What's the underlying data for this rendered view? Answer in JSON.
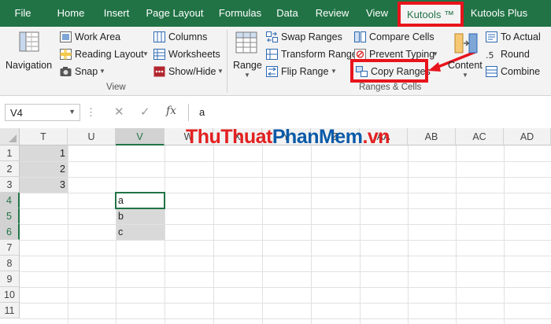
{
  "tabs": {
    "file": "File",
    "home": "Home",
    "insert": "Insert",
    "page_layout": "Page Layout",
    "formulas": "Formulas",
    "data": "Data",
    "review": "Review",
    "view": "View",
    "kutools": "Kutools ™",
    "kutools_plus": "Kutools Plus"
  },
  "ribbon": {
    "view_group": {
      "label": "View",
      "navigation": "Navigation",
      "work_area": "Work Area",
      "reading_layout": "Reading Layout",
      "snap": "Snap",
      "columns": "Columns",
      "worksheets": "Worksheets",
      "show_hide": "Show/Hide"
    },
    "ranges_group": {
      "label": "Ranges & Cells",
      "range": "Range",
      "swap_ranges": "Swap Ranges",
      "transform_range": "Transform Range",
      "flip_range": "Flip Range",
      "compare_cells": "Compare Cells",
      "prevent_typing": "Prevent Typing",
      "copy_ranges": "Copy Ranges",
      "content": "Content",
      "to_actual": "To Actual",
      "round": "Round",
      "combine": "Combine"
    }
  },
  "formula_bar": {
    "name_box": "V4",
    "value": "a",
    "cancel_glyph": "✕",
    "enter_glyph": "✓",
    "fx_glyph": "fx"
  },
  "grid": {
    "columns": [
      "T",
      "U",
      "V",
      "W",
      "X",
      "Y",
      "Z",
      "AA",
      "AB",
      "AC",
      "AD"
    ],
    "rows": [
      "1",
      "2",
      "3",
      "4",
      "5",
      "6",
      "7",
      "8",
      "9",
      "10",
      "11"
    ],
    "cells": {
      "T1": "1",
      "T2": "2",
      "T3": "3",
      "V4": "a",
      "V5": "b",
      "V6": "c"
    }
  },
  "watermark": {
    "part1": "ThuThuat",
    "part2": "PhanMem",
    "part3": ".vn"
  },
  "colors": {
    "excel_green": "#217346",
    "highlight_red": "#e8141c",
    "selection_gray": "#d9d9d9"
  },
  "icons": {
    "navigation": "navigation-pane-icon",
    "work_area": "work-area-icon",
    "reading_layout": "reading-layout-icon",
    "snap": "camera-icon",
    "columns": "columns-icon",
    "worksheets": "worksheets-icon",
    "show_hide": "show-hide-icon",
    "range": "range-grid-icon",
    "swap_ranges": "swap-ranges-icon",
    "transform_range": "transform-range-icon",
    "flip_range": "flip-range-icon",
    "compare_cells": "compare-cells-icon",
    "prevent_typing": "prevent-typing-icon",
    "copy_ranges": "copy-ranges-icon",
    "content": "content-icon",
    "to_actual": "to-actual-icon",
    "round": "round-icon",
    "combine": "combine-icon"
  }
}
